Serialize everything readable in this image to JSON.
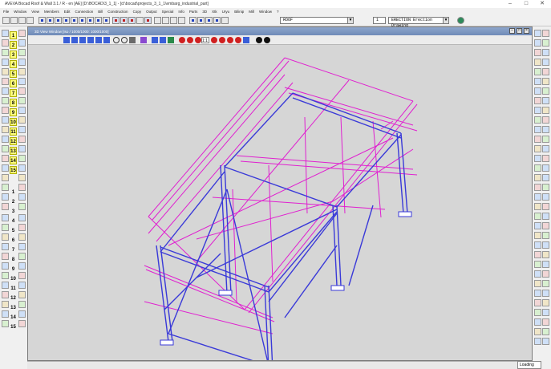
{
  "app": {
    "title": "AVEVA Bocad Roof & Wall 3.1 / R - en [AE]  [D:\\BOCAD\\3_1_1] - [d:\\bocad\\projects_3_1_1\\embarg_industrial_part]"
  },
  "menu": {
    "items": [
      "File",
      "Window",
      "View",
      "Members",
      "Edit",
      "Connection",
      "Bill",
      "Construction",
      "Copy",
      "Output",
      "Special",
      "Info",
      "Parts",
      "3D",
      "Xtk",
      "Uryu",
      "Bilinip",
      "Mill",
      "Window",
      "?"
    ]
  },
  "toolbar": {
    "layer_value": "ROOF",
    "count_value": "1",
    "phase_value": "ERECTION   Erection Drawing"
  },
  "palette": {
    "top_numbers": [
      "1",
      "2",
      "3",
      "4",
      "5",
      "6",
      "7",
      "8",
      "9",
      "10",
      "11",
      "12",
      "13",
      "14",
      "15"
    ],
    "bottom_numbers": [
      "1",
      "2",
      "3",
      "4",
      "5",
      "6",
      "7",
      "8",
      "9",
      "10",
      "11",
      "12",
      "13",
      "14",
      "15"
    ]
  },
  "document": {
    "title": "3D View Window [Iso / 1000/1000: 1000/1000]",
    "zoom_value": "1:1"
  },
  "status": {
    "text": "Loading"
  },
  "colors": {
    "steel_blue": "#3a3ad8",
    "secondary_magenta": "#e020d0",
    "viewport_bg": "#d6d6d6",
    "window_title": "#7a93c2"
  }
}
